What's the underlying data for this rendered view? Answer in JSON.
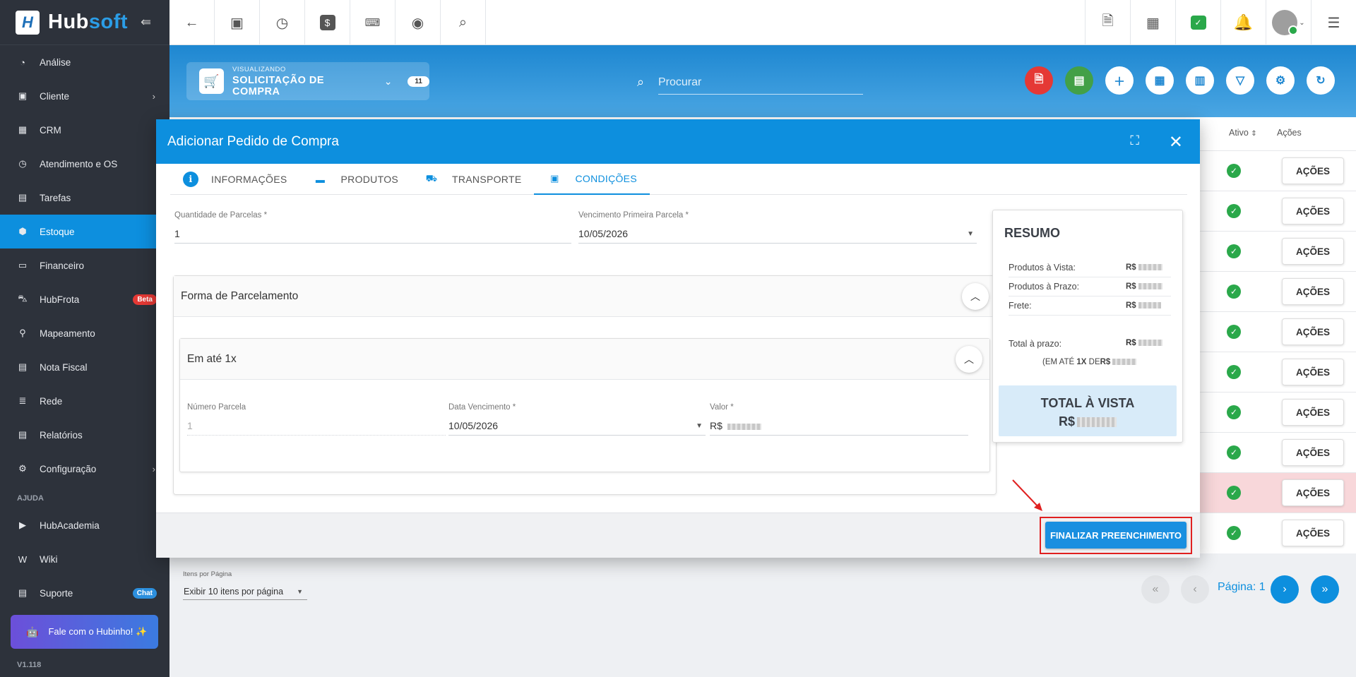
{
  "sidebar": {
    "brand": {
      "mark": "H",
      "name_a": "Hub",
      "name_b": "soft"
    },
    "items": [
      {
        "label": "Análise",
        "icon": "chart-pie-icon"
      },
      {
        "label": "Cliente",
        "icon": "id-card-icon",
        "has_children": true
      },
      {
        "label": "CRM",
        "icon": "kanban-icon"
      },
      {
        "label": "Atendimento e OS",
        "icon": "calendar-clock-icon"
      },
      {
        "label": "Tarefas",
        "icon": "clipboard-icon"
      },
      {
        "label": "Estoque",
        "icon": "cube-icon",
        "active": true
      },
      {
        "label": "Financeiro",
        "icon": "money-icon"
      },
      {
        "label": "HubFrota",
        "icon": "car-icon",
        "badge": "Beta"
      },
      {
        "label": "Mapeamento",
        "icon": "map-pin-icon"
      },
      {
        "label": "Nota Fiscal",
        "icon": "receipt-icon"
      },
      {
        "label": "Rede",
        "icon": "server-icon"
      },
      {
        "label": "Relatórios",
        "icon": "report-icon"
      },
      {
        "label": "Configuração",
        "icon": "gear-icon",
        "has_children": true
      }
    ],
    "help_section": "AJUDA",
    "help_items": [
      {
        "label": "HubAcademia",
        "icon": "play-icon"
      },
      {
        "label": "Wiki",
        "icon": "wiki-icon"
      },
      {
        "label": "Suporte",
        "icon": "support-icon",
        "badge": "Chat"
      }
    ],
    "hubinho": "Fale com o Hubinho! ✨",
    "version": "V1.118"
  },
  "header": {
    "viewing_small": "VISUALIZANDO",
    "viewing_title": "SOLICITAÇÃO DE COMPRA",
    "viewing_count": "11",
    "search_placeholder": "Procurar"
  },
  "table": {
    "col_ativo": "Ativo",
    "col_acoes": "Ações",
    "action_label": "AÇÕES",
    "rows": 10,
    "highlighted_row": 8
  },
  "pagination": {
    "per_page_label": "Itens por Página",
    "per_page_value": "Exibir 10 itens por página",
    "page_label": "Página: 1"
  },
  "modal": {
    "title": "Adicionar Pedido de Compra",
    "tabs": [
      {
        "label": "INFORMAÇÕES",
        "icon": "info-icon"
      },
      {
        "label": "PRODUTOS",
        "icon": "box-icon"
      },
      {
        "label": "TRANSPORTE",
        "icon": "truck-icon"
      },
      {
        "label": "CONDIÇÕES",
        "icon": "cash-icon",
        "active": true
      }
    ],
    "qtd_parcelas_label": "Quantidade de Parcelas *",
    "qtd_parcelas_value": "1",
    "venc_primeira_label": "Vencimento Primeira Parcela *",
    "venc_primeira_value": "10/05/2026",
    "forma_parcelamento": "Forma de Parcelamento",
    "em_ate": "Em até 1x",
    "numero_parcela_label": "Número Parcela",
    "numero_parcela_value": "1",
    "data_venc_label": "Data Vencimento *",
    "data_venc_value": "10/05/2026",
    "valor_label": "Valor *",
    "valor_prefix": "R$",
    "finalizar": "FINALIZAR PREENCHIMENTO"
  },
  "resumo": {
    "title": "RESUMO",
    "produtos_vista": "Produtos à Vista:",
    "produtos_prazo": "Produtos à Prazo:",
    "frete": "Frete:",
    "total_prazo": "Total à prazo:",
    "currency": "R$",
    "em_ate_prefix": "(EM ATÉ ",
    "em_ate_x": "1X",
    "em_ate_de": " DE",
    "total_vista": "TOTAL À VISTA"
  },
  "colors": {
    "primary": "#0d8fde",
    "sidebar": "#2d323b",
    "success": "#2aa84a",
    "danger": "#e53935"
  }
}
